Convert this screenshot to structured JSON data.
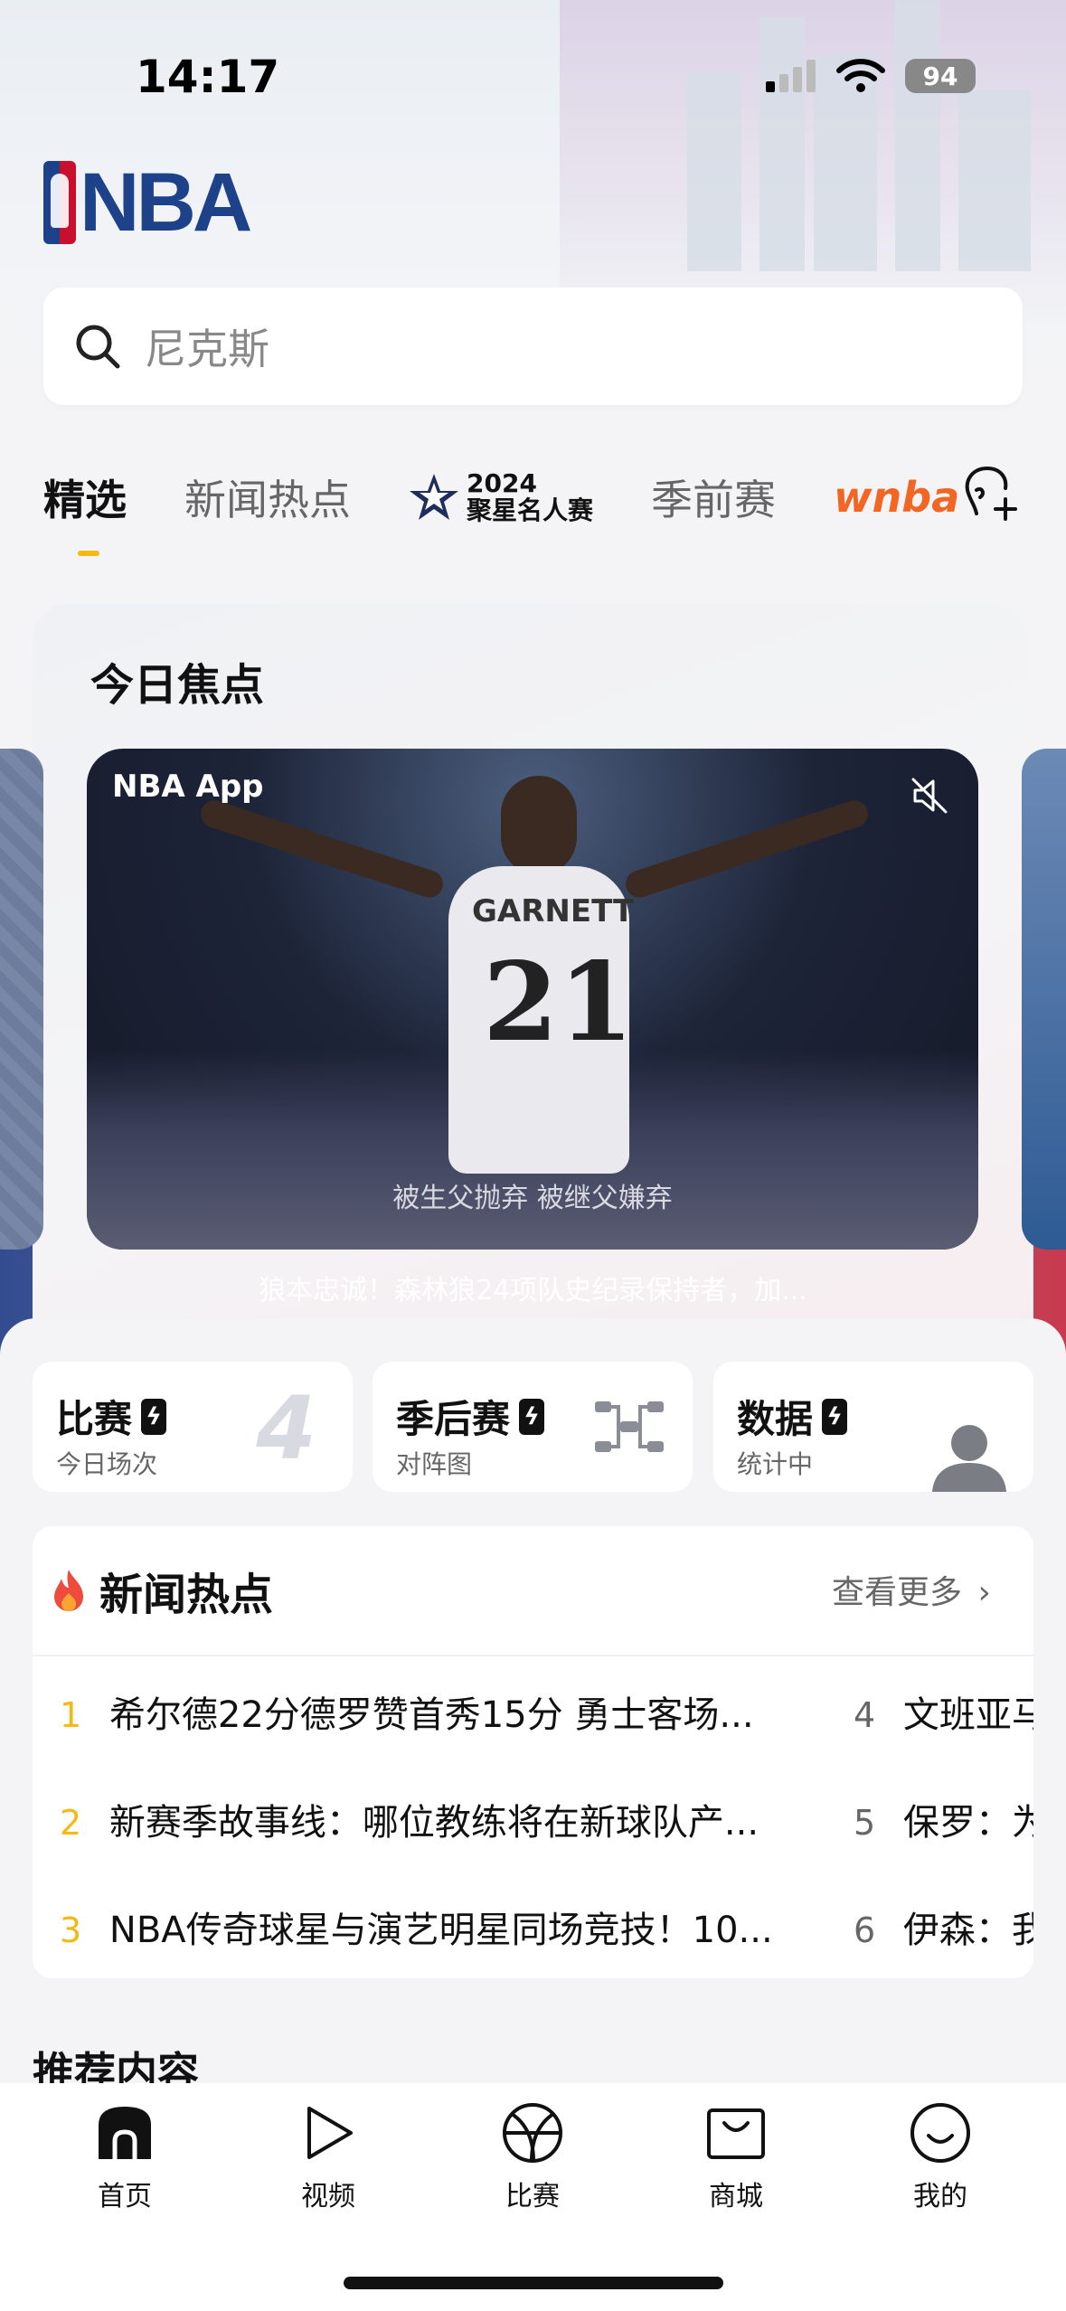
{
  "status_bar": {
    "time": "14:17",
    "battery": "94"
  },
  "logo": {
    "text": "NBA"
  },
  "search": {
    "placeholder": "尼克斯"
  },
  "tabs": [
    {
      "label": "精选"
    },
    {
      "label": "新闻热点"
    },
    {
      "year": "2024",
      "label": "聚星名人赛"
    },
    {
      "label": "季前赛"
    },
    {
      "label": "wnba"
    }
  ],
  "focus": {
    "title": "今日焦点",
    "video_logo": "NBA App",
    "jersey_name": "GARNETT",
    "jersey_number": "21",
    "subtitle": "被生父抛弃  被继父嫌弃",
    "caption": "狼本忠诚！森林狼24项队史纪录保持者，加..."
  },
  "quick_cards": [
    {
      "title": "比赛",
      "subtitle": "今日场次",
      "value": "4"
    },
    {
      "title": "季后赛",
      "subtitle": "对阵图"
    },
    {
      "title": "数据",
      "subtitle": "统计中"
    }
  ],
  "news": {
    "title": "新闻热点",
    "more": "查看更多",
    "items": [
      {
        "rank": "1",
        "text": "希尔德22分德罗赞首秀15分 勇士客场..."
      },
      {
        "rank": "2",
        "text": "新赛季故事线：哪位教练将在新球队产..."
      },
      {
        "rank": "3",
        "text": "NBA传奇球星与演艺明星同场竞技！10..."
      },
      {
        "rank": "4",
        "text": "文班亚马"
      },
      {
        "rank": "5",
        "text": "保罗：为"
      },
      {
        "rank": "6",
        "text": "伊森：我"
      }
    ],
    "rank_colors": [
      "#f5b914",
      "#f5b914",
      "#f5b914",
      "#666666",
      "#666666",
      "#666666"
    ]
  },
  "recommend": {
    "title": "推荐内容"
  },
  "tabbar": [
    {
      "label": "首页",
      "icon": "home-icon"
    },
    {
      "label": "视频",
      "icon": "play-icon"
    },
    {
      "label": "比赛",
      "icon": "basketball-icon"
    },
    {
      "label": "商城",
      "icon": "bag-icon"
    },
    {
      "label": "我的",
      "icon": "smile-icon"
    }
  ]
}
